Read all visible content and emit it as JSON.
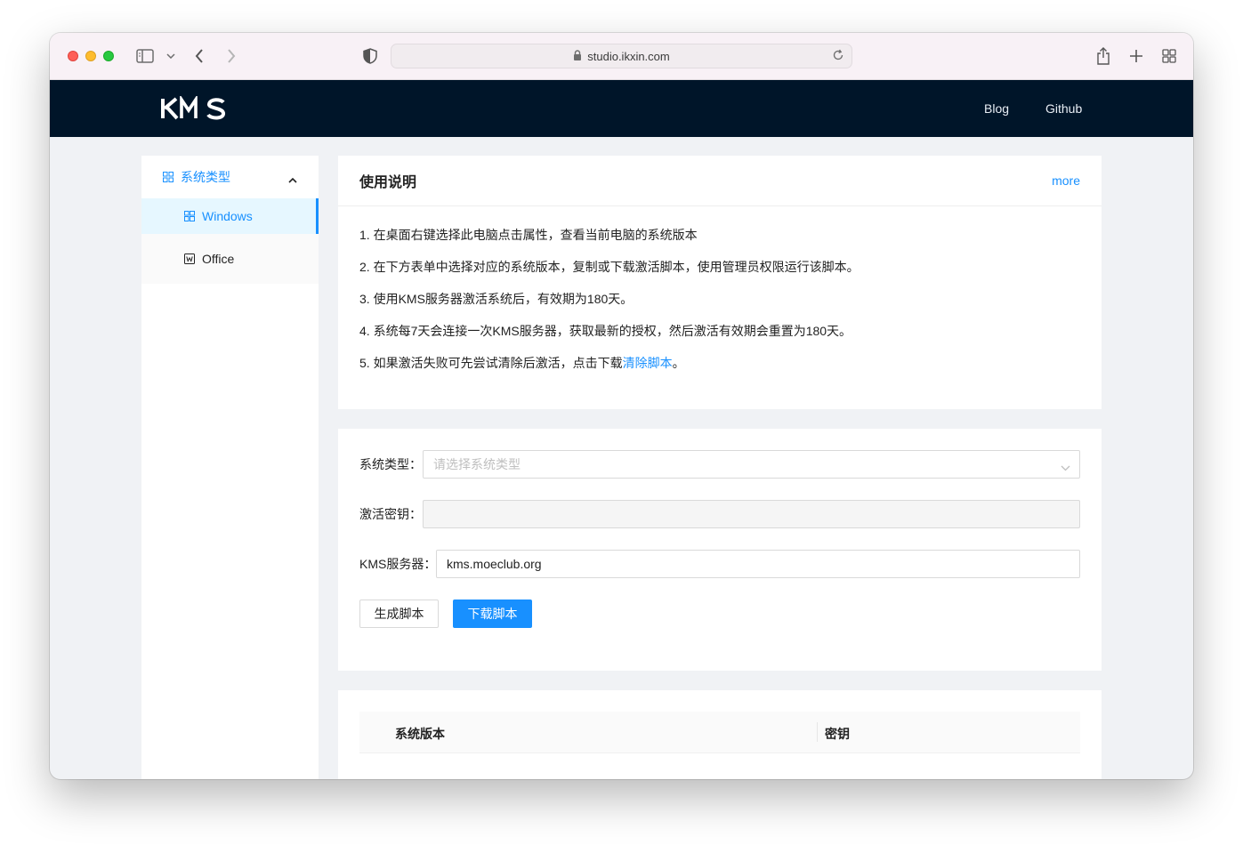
{
  "browser": {
    "url": "studio.ikxin.com"
  },
  "site": {
    "logo_text": "KMS",
    "nav": [
      {
        "label": "Blog"
      },
      {
        "label": "Github"
      }
    ]
  },
  "sidebar": {
    "group_label": "系统类型",
    "items": [
      {
        "label": "Windows",
        "icon": "windows-grid-icon",
        "active": true
      },
      {
        "label": "Office",
        "icon": "word-doc-icon",
        "active": false
      }
    ]
  },
  "instructions_card": {
    "title": "使用说明",
    "more": "more",
    "lines": [
      "1. 在桌面右键选择此电脑点击属性，查看当前电脑的系统版本",
      "2. 在下方表单中选择对应的系统版本，复制或下载激活脚本，使用管理员权限运行该脚本。",
      "3. 使用KMS服务器激活系统后，有效期为180天。",
      "4. 系统每7天会连接一次KMS服务器，获取最新的授权，然后激活有效期会重置为180天。"
    ],
    "line5_prefix": "5. 如果激活失败可先尝试清除后激活，点击下载",
    "line5_link": "清除脚本",
    "line5_suffix": "。"
  },
  "form": {
    "system_type_label": "系统类型：",
    "system_type_placeholder": "请选择系统类型",
    "key_label": "激活密钥：",
    "key_value": "",
    "kms_label": "KMS服务器：",
    "kms_value": "kms.moeclub.org",
    "generate_button": "生成脚本",
    "download_button": "下载脚本"
  },
  "table": {
    "columns": [
      "系统版本",
      "密钥"
    ]
  },
  "colors": {
    "accent": "#1890ff",
    "header_bg": "#001529",
    "page_bg": "#f0f2f5"
  }
}
